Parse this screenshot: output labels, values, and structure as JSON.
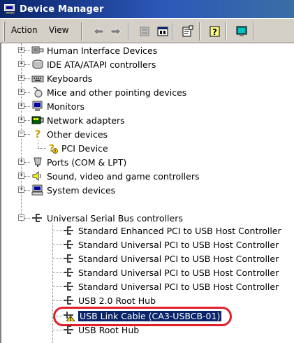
{
  "window": {
    "title": "Device Manager"
  },
  "menu": {
    "action": "Action",
    "view": "View"
  },
  "toolbar_icons": [
    "back-arrow-icon",
    "forward-arrow-icon",
    "properties-disabled-icon",
    "show-hidden-icon",
    "properties-icon",
    "help-icon",
    "scan-hardware-icon"
  ],
  "tree": {
    "human_interface": "Human Interface Devices",
    "ide": "IDE ATA/ATAPI controllers",
    "keyboards": "Keyboards",
    "mice": "Mice and other pointing devices",
    "monitors": "Monitors",
    "network": "Network adapters",
    "other": "Other devices",
    "pci_device": "PCI Device",
    "ports": "Ports (COM & LPT)",
    "sound": "Sound, video and game controllers",
    "system": "System devices",
    "usb_controllers": "Universal Serial Bus controllers",
    "usb_children": [
      "Standard Enhanced PCI to USB Host Controller",
      "Standard Universal PCI to USB Host Controller",
      "Standard Universal PCI to USB Host Controller",
      "Standard Universal PCI to USB Host Controller",
      "Standard Universal PCI to USB Host Controller",
      "USB 2.0 Root Hub",
      "USB Link Cable (CA3-USBCB-01)",
      "USB Root Hub"
    ]
  },
  "colors": {
    "title_bar": "#0a246a",
    "selection": "#0a246a",
    "highlight_ring": "#e0202a",
    "toolbar": "#d4d0c8"
  }
}
